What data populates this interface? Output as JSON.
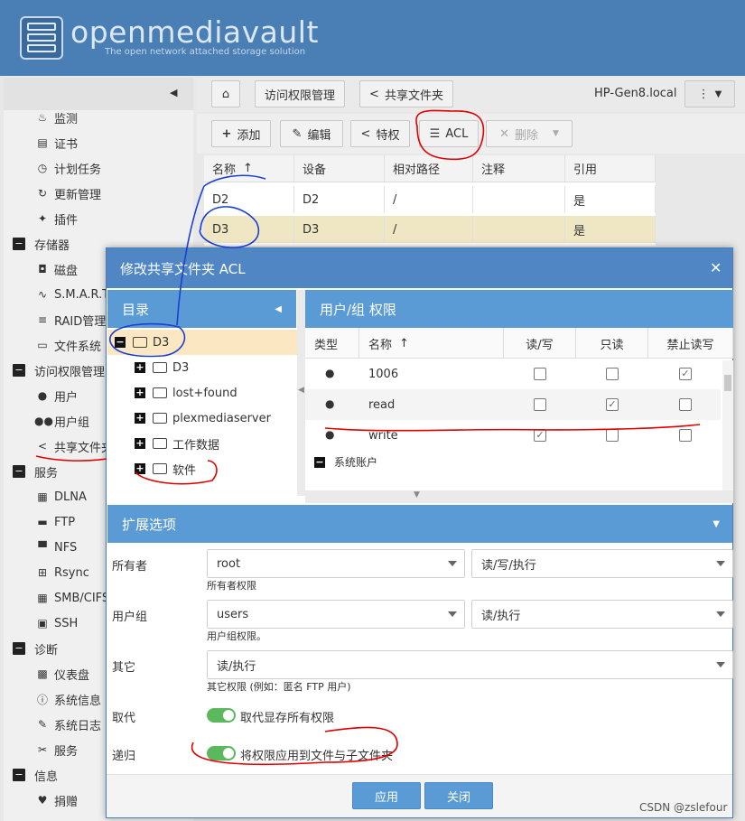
{
  "app": {
    "title": "openmediavault",
    "subtitle": "The open network attached storage solution",
    "hostname": "HP-Gen8.local"
  },
  "nav": {
    "items": [
      {
        "label": "监测",
        "icon": "monitor-icon",
        "group": false
      },
      {
        "label": "证书",
        "icon": "certificate-icon",
        "group": false
      },
      {
        "label": "计划任务",
        "icon": "clock-icon",
        "group": false
      },
      {
        "label": "更新管理",
        "icon": "refresh-icon",
        "group": false
      },
      {
        "label": "插件",
        "icon": "puzzle-icon",
        "group": false
      },
      {
        "label": "存储器",
        "icon": "minus-icon",
        "group": true
      },
      {
        "label": "磁盘",
        "icon": "disk-icon",
        "group": false
      },
      {
        "label": "S.M.A.R.T.",
        "icon": "pulse-icon",
        "group": false
      },
      {
        "label": "RAID管理",
        "icon": "database-icon",
        "group": false
      },
      {
        "label": "文件系统",
        "icon": "folder-icon",
        "group": false
      },
      {
        "label": "访问权限管理",
        "icon": "minus-icon",
        "group": true
      },
      {
        "label": "用户",
        "icon": "user-icon",
        "group": false
      },
      {
        "label": "用户组",
        "icon": "users-icon",
        "group": false
      },
      {
        "label": "共享文件夹",
        "icon": "share-icon",
        "group": false
      },
      {
        "label": "服务",
        "icon": "minus-icon",
        "group": true
      },
      {
        "label": "DLNA",
        "icon": "film-icon",
        "group": false
      },
      {
        "label": "FTP",
        "icon": "server-icon",
        "group": false
      },
      {
        "label": "NFS",
        "icon": "desktop-icon",
        "group": false
      },
      {
        "label": "Rsync",
        "icon": "network-icon",
        "group": false
      },
      {
        "label": "SMB/CIFS",
        "icon": "windows-icon",
        "group": false
      },
      {
        "label": "SSH",
        "icon": "terminal-icon",
        "group": false
      },
      {
        "label": "诊断",
        "icon": "minus-icon",
        "group": true
      },
      {
        "label": "仪表盘",
        "icon": "dashboard-icon",
        "group": false
      },
      {
        "label": "系统信息",
        "icon": "info-icon",
        "group": false
      },
      {
        "label": "系统日志",
        "icon": "edit-icon",
        "group": false
      },
      {
        "label": "服务",
        "icon": "wrench-icon",
        "group": false
      },
      {
        "label": "信息",
        "icon": "minus-icon",
        "group": true
      },
      {
        "label": "捐赠",
        "icon": "heart-icon",
        "group": false
      }
    ]
  },
  "breadcrumb": {
    "home_icon": "home-icon",
    "crumb1": "访问权限管理",
    "crumb2": "共享文件夹"
  },
  "toolbar": {
    "add": "添加",
    "edit": "编辑",
    "privileges": "特权",
    "acl": "ACL",
    "delete": "删除"
  },
  "grid": {
    "columns": [
      "名称",
      "设备",
      "相对路径",
      "注释",
      "引用"
    ],
    "rows": [
      {
        "name": "D2",
        "device": "D2",
        "path": "/",
        "comment": "",
        "ref": "是"
      },
      {
        "name": "D3",
        "device": "D3",
        "path": "/",
        "comment": "",
        "ref": "是"
      }
    ]
  },
  "dialog": {
    "title": "修改共享文件夹 ACL",
    "tree": {
      "header": "目录",
      "root": "D3",
      "children": [
        "D3",
        "lost+found",
        "plexmediaserver",
        "工作数据",
        "软件"
      ]
    },
    "perms": {
      "header": "用户/组 权限",
      "columns": [
        "类型",
        "名称",
        "读/写",
        "只读",
        "禁止读写"
      ],
      "rows": [
        {
          "name": "1006",
          "rw": false,
          "ro": false,
          "none": true
        },
        {
          "name": "read",
          "rw": false,
          "ro": true,
          "none": false
        },
        {
          "name": "write",
          "rw": true,
          "ro": false,
          "none": false
        }
      ],
      "group_label": "系统账户"
    },
    "ext": {
      "header": "扩展选项",
      "owner_label": "所有者",
      "owner_value": "root",
      "owner_perm": "读/写/执行",
      "owner_hint": "所有者权限",
      "group_label": "用户组",
      "group_value": "users",
      "group_perm": "读/执行",
      "group_hint": "用户组权限。",
      "other_label": "其它",
      "other_perm": "读/执行",
      "other_hint": "其它权限 (例如：匿名 FTP 用户)",
      "replace_label": "取代",
      "replace_text": "取代显存所有权限",
      "replace_on": true,
      "recursive_label": "递归",
      "recursive_text": "将权限应用到文件与子文件夹",
      "recursive_on": true
    },
    "apply": "应用",
    "close": "关闭"
  },
  "watermark": "CSDN @zslefour"
}
